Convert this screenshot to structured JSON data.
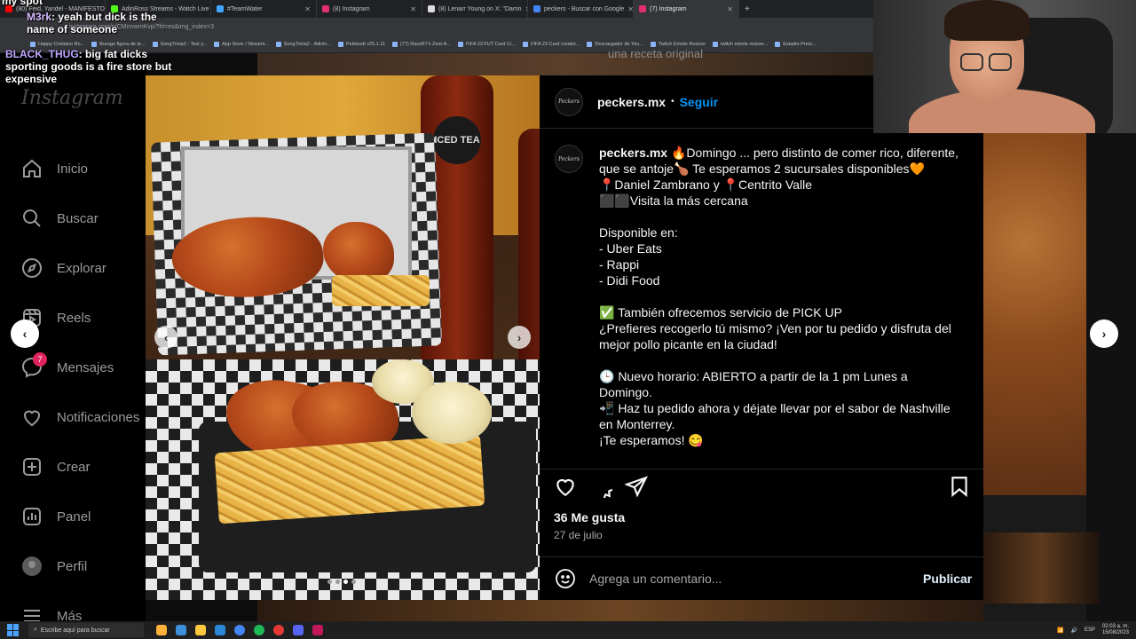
{
  "browser": {
    "tabs": [
      {
        "label": "(80) Feid, Yandel - MANIFESTO",
        "color": "#ff0000"
      },
      {
        "label": "AdinRoss Streams - Watch Live",
        "color": "#53fc18"
      },
      {
        "label": "#TeamWater",
        "color": "#3ea6ff"
      },
      {
        "label": "(8) Instagram",
        "color": "#e1306c"
      },
      {
        "label": "(8) Lenarr Young on X: \"Damn",
        "color": "#dddddd"
      },
      {
        "label": "peckers - Buscar con Google",
        "color": "#4285f4"
      },
      {
        "label": "(7) Instagram",
        "color": "#e1306c"
      }
    ],
    "new_tab": "+",
    "url": "instagram.com/p/CMnnwrnKvp/?hl=es&img_index=3",
    "bookmarks": [
      "Happy Cristiano Ro...",
      "Burago figura de te...",
      "SongTrivia2 - Test y...",
      "App Store / Streami...",
      "SongTrivia2 - Adivin...",
      "Peletoob v25.1.11",
      "(77) RazzR7's Zest-A...",
      "FIFA 23 FUT Card Cr...",
      "FIFA 23 Card creator...",
      "Descargador de You...",
      "Twitch Emote Resizer",
      "twitch emote resizer...",
      "Estadio Presi..."
    ]
  },
  "chat": {
    "lines": [
      {
        "user": "",
        "text": "my spot"
      },
      {
        "user": "M3rk",
        "text": ": yeah but dick is the name of someone"
      },
      {
        "user": "BLACK_THUG",
        "text": ": big fat dicks sporting goods is a fire store but expensive"
      }
    ]
  },
  "sidebar": {
    "logo": "Instagram",
    "items": [
      {
        "label": "Inicio",
        "icon": "home-icon"
      },
      {
        "label": "Buscar",
        "icon": "search-icon"
      },
      {
        "label": "Explorar",
        "icon": "compass-icon"
      },
      {
        "label": "Reels",
        "icon": "reels-icon"
      },
      {
        "label": "Mensajes",
        "icon": "messenger-icon",
        "badge": "7"
      },
      {
        "label": "Notificaciones",
        "icon": "heart-icon"
      },
      {
        "label": "Crear",
        "icon": "plus-square-icon"
      },
      {
        "label": "Panel",
        "icon": "chart-icon"
      },
      {
        "label": "Perfil",
        "icon": "avatar"
      },
      {
        "label": "Más",
        "icon": "menu-icon"
      }
    ]
  },
  "background": {
    "top_text": "una receta original"
  },
  "photo": {
    "bottle_label": "ICED TEA",
    "carousel_total": 4,
    "carousel_active": 3
  },
  "post": {
    "username": "peckers.mx",
    "avatar_text": "Peckers",
    "follow_label": "Seguir",
    "caption_lines": [
      "🔥Domingo ... pero distinto de comer rico, diferente, que se antoje🍗 Te esperamos 2 sucursales disponibles🧡",
      "📍Daniel Zambrano y 📍Centrito Valle",
      "⬛⬛Visita la más cercana",
      "",
      "Disponible en:",
      "- Uber Eats",
      "- Rappi",
      "- Didi Food",
      "",
      "✅ También ofrecemos servicio de PICK UP",
      "¿Prefieres recogerlo tú mismo? ¡Ven por tu pedido y disfruta del mejor pollo picante en la ciudad!",
      "",
      "🕒 Nuevo horario: ABIERTO a partir de la 1 pm Lunes a Domingo.",
      "📲 Haz tu pedido ahora y déjate llevar por el sabor de Nashville en Monterrey.",
      "¡Te esperamos! 😋"
    ],
    "likes": "36 Me gusta",
    "date": "27 de julio",
    "comment_placeholder": "Agrega un comentario...",
    "publish_label": "Publicar"
  },
  "taskbar": {
    "search_placeholder": "Escribe aquí para buscar",
    "lang": "ESP",
    "time": "02:03 a. m.",
    "date": "15/08/2023"
  },
  "colors": {
    "accent": "#0095f6",
    "badge": "#e0245e"
  }
}
